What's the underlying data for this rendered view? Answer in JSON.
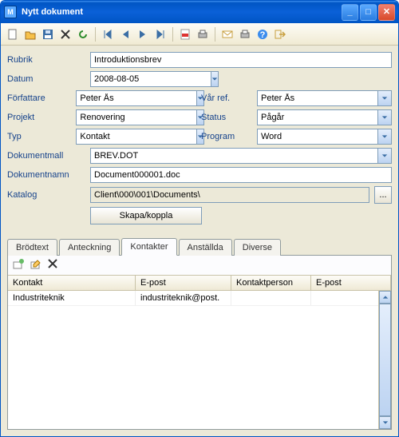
{
  "window": {
    "title": "Nytt dokument"
  },
  "labels": {
    "rubrik": "Rubrik",
    "datum": "Datum",
    "forfattare": "Författare",
    "projekt": "Projekt",
    "typ": "Typ",
    "dokmall": "Dokumentmall",
    "doknamn": "Dokumentnamn",
    "katalog": "Katalog",
    "varref": "Vår ref.",
    "status": "Status",
    "program": "Program"
  },
  "values": {
    "rubrik": "Introduktionsbrev",
    "datum": "2008-08-05",
    "forfattare": "Peter Ås",
    "projekt": "Renovering",
    "typ": "Kontakt",
    "dokmall": "BREV.DOT",
    "doknamn": "Document000001.doc",
    "katalog": "Client\\000\\001\\Documents\\",
    "varref": "Peter Ås",
    "status": "Pågår",
    "program": "Word"
  },
  "buttons": {
    "skapa": "Skapa/koppla",
    "browse": "..."
  },
  "tabs": {
    "brodtext": "Brödtext",
    "anteckning": "Anteckning",
    "kontakter": "Kontakter",
    "anstallda": "Anställda",
    "diverse": "Diverse"
  },
  "grid": {
    "headers": {
      "kontakt": "Kontakt",
      "epost1": "E-post",
      "kontaktperson": "Kontaktperson",
      "epost2": "E-post"
    },
    "rows": [
      {
        "kontakt": "Industriteknik",
        "epost1": "industriteknik@post.",
        "kontaktperson": "",
        "epost2": ""
      }
    ]
  }
}
